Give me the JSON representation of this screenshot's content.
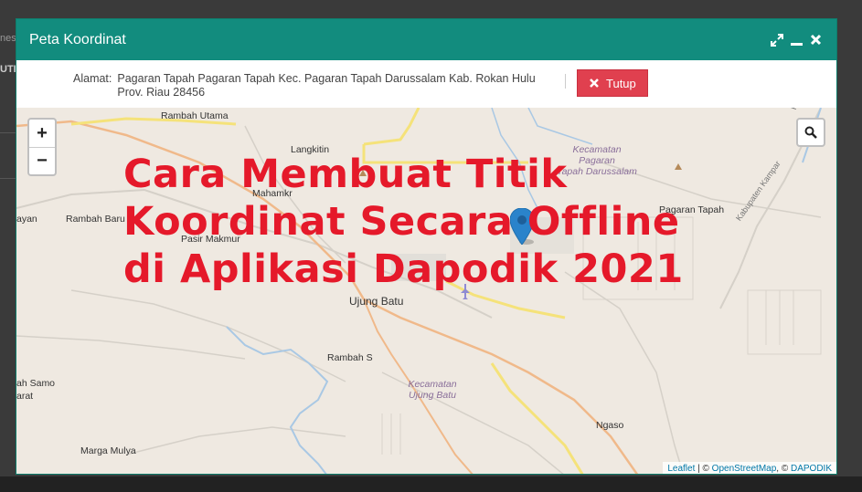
{
  "background": {
    "texts": [
      "nes",
      "UTI",
      "ayan",
      "Samo",
      "arat"
    ]
  },
  "dialog": {
    "title": "Peta Koordinat",
    "controls": [
      "expand-icon",
      "minimize-icon",
      "close-icon"
    ],
    "address_label": "Alamat:",
    "address_value": "Pagaran Tapah Pagaran Tapah Kec. Pagaran Tapah Darussalam Kab. Rokan Hulu Prov. Riau 28456",
    "close_button_label": "Tutup",
    "accent_color": "#128c7e",
    "danger_color": "#e0404f"
  },
  "map": {
    "zoom_in": "+",
    "zoom_out": "−",
    "places": {
      "rambah_utama": "Rambah Utama",
      "langkitin": "Langkitin",
      "rambah_baru": "Rambah Baru",
      "pasir_makmur": "Pasir Makmur",
      "ujung_batu": "Ujung Batu",
      "pagaran_tapah": "Pagaran Tapah",
      "ngaso": "Ngaso",
      "marga_mulya": "Marga Mulya",
      "rambah_samo": "ah Samo",
      "sarat": "arat",
      "ayan": "ayan",
      "mahamkr": "Mahamkr",
      "rambah_s": "Rambah S",
      "kabupaten_kampar": "Kabupaten Kampar",
      "ro": "Ro"
    },
    "districts": {
      "pagaran_tapah_darussalam": [
        "Kecamatan",
        "Pagaran",
        "Tapah Darussalam"
      ],
      "ujung_batu": [
        "Kecamatan",
        "Ujung Batu"
      ]
    },
    "attribution": {
      "leaflet": "Leaflet",
      "sep1": " | © ",
      "osm": "OpenStreetMap",
      "sep2": ", © ",
      "dapodik": "DAPODIK"
    }
  },
  "overlay": {
    "line1": "Cara Membuat Titik",
    "line2": "Koordinat Secara Offline",
    "line3": "di Aplikasi Dapodik 2021",
    "color": "#e5192a"
  }
}
